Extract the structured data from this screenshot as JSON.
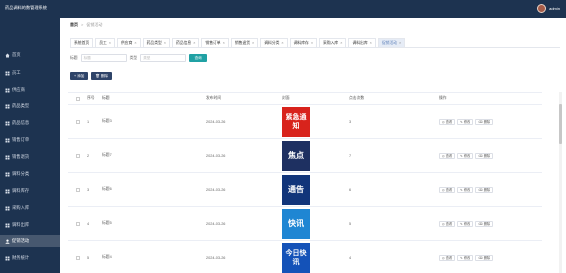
{
  "app": {
    "title": "药品调料的数管理系统"
  },
  "sidebar": {
    "items": [
      {
        "label": "首页",
        "icon": "home-icon"
      },
      {
        "label": "员工",
        "icon": "grid-icon"
      },
      {
        "label": "供应商",
        "icon": "grid-icon"
      },
      {
        "label": "药品类型",
        "icon": "grid-icon"
      },
      {
        "label": "药品信息",
        "icon": "grid-icon"
      },
      {
        "label": "销售订单",
        "icon": "grid-icon"
      },
      {
        "label": "销售退货",
        "icon": "grid-icon"
      },
      {
        "label": "调料分类",
        "icon": "grid-icon"
      },
      {
        "label": "调料库存",
        "icon": "grid-icon"
      },
      {
        "label": "采购入库",
        "icon": "grid-icon"
      },
      {
        "label": "调料出库",
        "icon": "grid-icon"
      },
      {
        "label": "促销活动",
        "icon": "user-icon"
      },
      {
        "label": "财务统计",
        "icon": "grid-icon"
      }
    ],
    "active_index": 11
  },
  "header": {
    "user": "admin"
  },
  "breadcrumb": {
    "home": "首页",
    "sep": ">",
    "current": "促销活动"
  },
  "tabs": [
    {
      "label": "系统首页",
      "active": false,
      "closable": false
    },
    {
      "label": "员工",
      "active": false,
      "closable": true
    },
    {
      "label": "供应商",
      "active": false,
      "closable": true
    },
    {
      "label": "药品类型",
      "active": false,
      "closable": true
    },
    {
      "label": "药品信息",
      "active": false,
      "closable": true
    },
    {
      "label": "销售订单",
      "active": false,
      "closable": true
    },
    {
      "label": "销售退货",
      "active": false,
      "closable": true
    },
    {
      "label": "调料分类",
      "active": false,
      "closable": true
    },
    {
      "label": "调料库存",
      "active": false,
      "closable": true
    },
    {
      "label": "采购入库",
      "active": false,
      "closable": true
    },
    {
      "label": "调料出库",
      "active": false,
      "closable": true
    },
    {
      "label": "促销活动",
      "active": true,
      "closable": true
    }
  ],
  "search": {
    "title_label": "标题",
    "title_placeholder": "标题",
    "type_label": "类型",
    "type_placeholder": "类型",
    "button": "查询"
  },
  "actions": {
    "add": "添加",
    "delete": "删除"
  },
  "table": {
    "headers": {
      "index": "序号",
      "title": "标题",
      "date": "发布时间",
      "picture": "封面",
      "clicks": "点击次数",
      "ops": "操作"
    },
    "op_labels": {
      "view": "查看",
      "edit": "修改",
      "delete": "删除"
    },
    "rows": [
      {
        "index": "1",
        "title": "标题3",
        "date": "2024-03-26",
        "clicks": "3",
        "thumb_text": "紧急通知",
        "thumb_bg": "#d8231c",
        "thumb_fg": "#ffffff"
      },
      {
        "index": "2",
        "title": "标题7",
        "date": "2024-03-26",
        "clicks": "7",
        "thumb_text": "焦点",
        "thumb_bg": "#1e3061",
        "thumb_fg": "#ffffff"
      },
      {
        "index": "3",
        "title": "标题6",
        "date": "2024-03-26",
        "clicks": "6",
        "thumb_text": "通告",
        "thumb_bg": "#12357a",
        "thumb_fg": "#ffffff"
      },
      {
        "index": "4",
        "title": "标题5",
        "date": "2024-03-26",
        "clicks": "5",
        "thumb_text": "快讯",
        "thumb_bg": "#1f86d3",
        "thumb_fg": "#ffffff"
      },
      {
        "index": "5",
        "title": "标题4",
        "date": "2024-03-26",
        "clicks": "4",
        "thumb_text": "今日快讯",
        "thumb_bg": "#1452b8",
        "thumb_fg": "#ffffff"
      }
    ]
  },
  "colors": {
    "sidebar_bg": "#1d3350",
    "active_menu_bg": "#47586f",
    "accent": "#20a1a4",
    "button_dark": "#2e4368"
  }
}
